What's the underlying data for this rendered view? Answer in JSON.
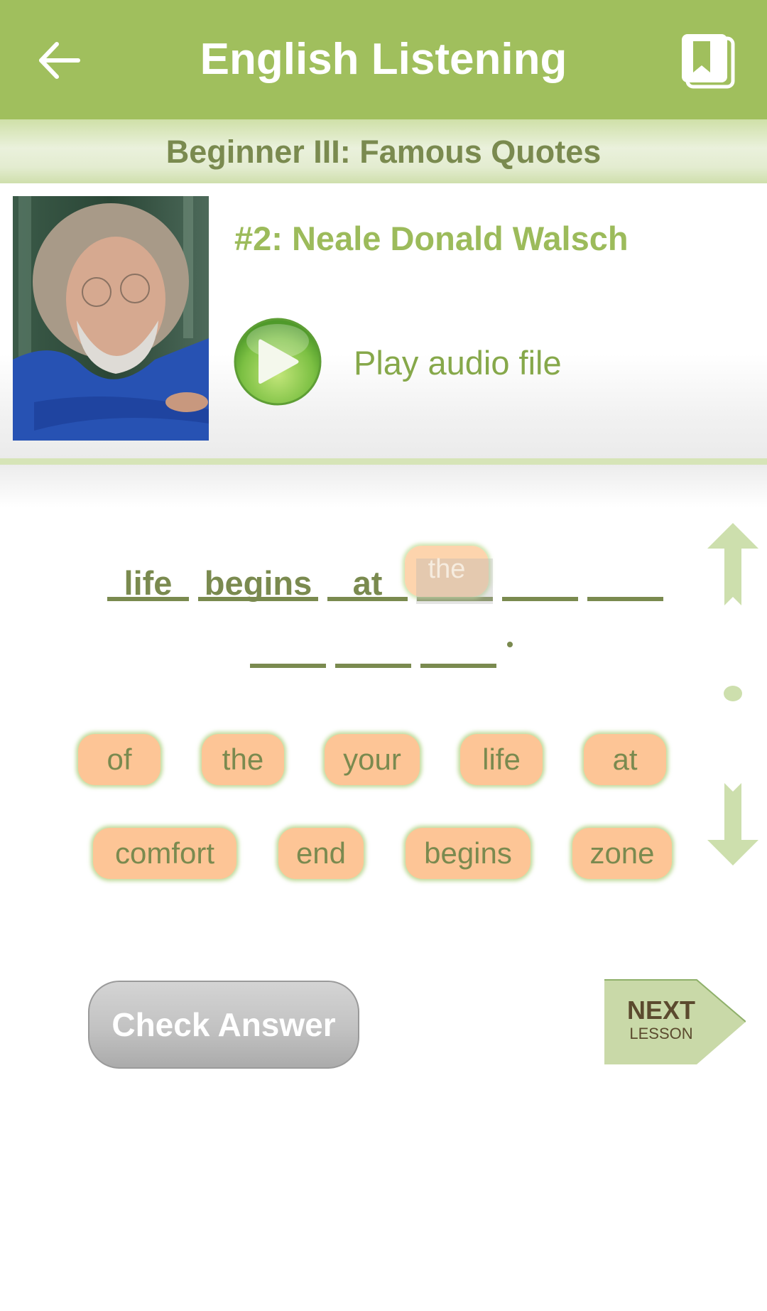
{
  "app_bar": {
    "title": "English Listening",
    "back_icon": "arrow-left-icon",
    "book_icon": "bookmark-book-icon"
  },
  "level": {
    "title": "Beginner III: Famous Quotes"
  },
  "lesson": {
    "title": "#2: Neale Donald Walsch",
    "portrait_alt": "Portrait of Neale Donald Walsch",
    "play_icon": "play-circle-icon",
    "play_label": "Play audio file"
  },
  "sentence": {
    "slots": [
      {
        "word": "life"
      },
      {
        "word": "begins"
      },
      {
        "word": "at"
      },
      {
        "word": ""
      },
      {
        "word": ""
      },
      {
        "word": ""
      },
      {
        "word": ""
      },
      {
        "word": ""
      },
      {
        "word": ""
      }
    ],
    "punctuation": ".",
    "dragging_word": "the"
  },
  "word_bank": {
    "row1": [
      "of",
      "the",
      "your",
      "life",
      "at"
    ],
    "row2": [
      "comfort",
      "end",
      "begins",
      "zone"
    ]
  },
  "scroll": {
    "up_icon": "arrow-up-icon",
    "dot_icon": "dot-icon",
    "down_icon": "arrow-down-icon"
  },
  "actions": {
    "check_label": "Check Answer",
    "next_main": "NEXT",
    "next_sub": "LESSON"
  },
  "colors": {
    "app_bar": "#a0bf5d",
    "accent_text": "#9cbb5b",
    "dark_olive": "#7a8a4f",
    "chip_fill": "#fdc596",
    "next_fill": "#c9d9a8",
    "next_text": "#5b4a2e"
  }
}
